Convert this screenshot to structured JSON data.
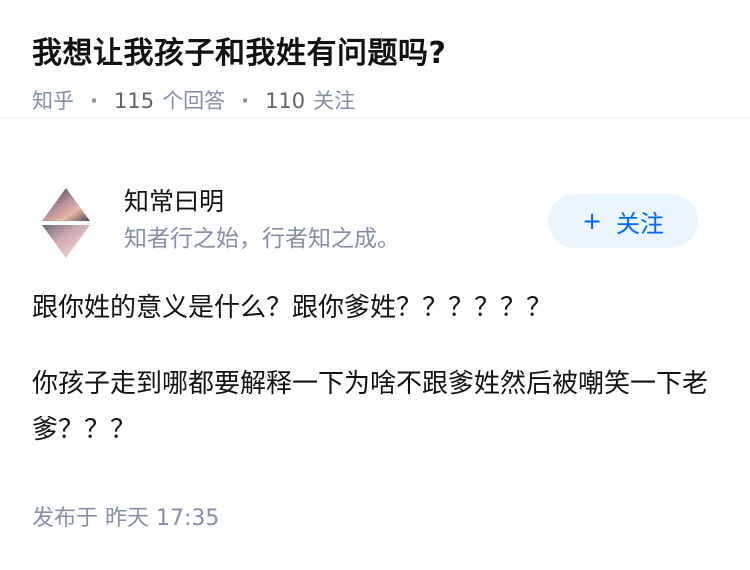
{
  "question": {
    "title": "我想让我孩子和我姓有问题吗?",
    "platform": "知乎",
    "answer_count": "115",
    "answer_label": "个回答",
    "follower_count": "110",
    "follower_label": "关注"
  },
  "author": {
    "name": "知常曰明",
    "bio": "知者行之始，行者知之成。",
    "avatar_icon": "diamond-reflection-avatar"
  },
  "follow_button": {
    "icon": "plus-icon",
    "plus": "+",
    "label": "关注",
    "accent_color": "#0066ff",
    "background_color": "#ebf5ff"
  },
  "answer": {
    "paragraphs": [
      "跟你姓的意义是什么？跟你爹姓？？？？？？",
      "你孩子走到哪都要解释一下为啥不跟爹姓然后被嘲笑一下老爹？？？"
    ],
    "time_prefix": "发布于",
    "time_value": "昨天 17:35"
  }
}
